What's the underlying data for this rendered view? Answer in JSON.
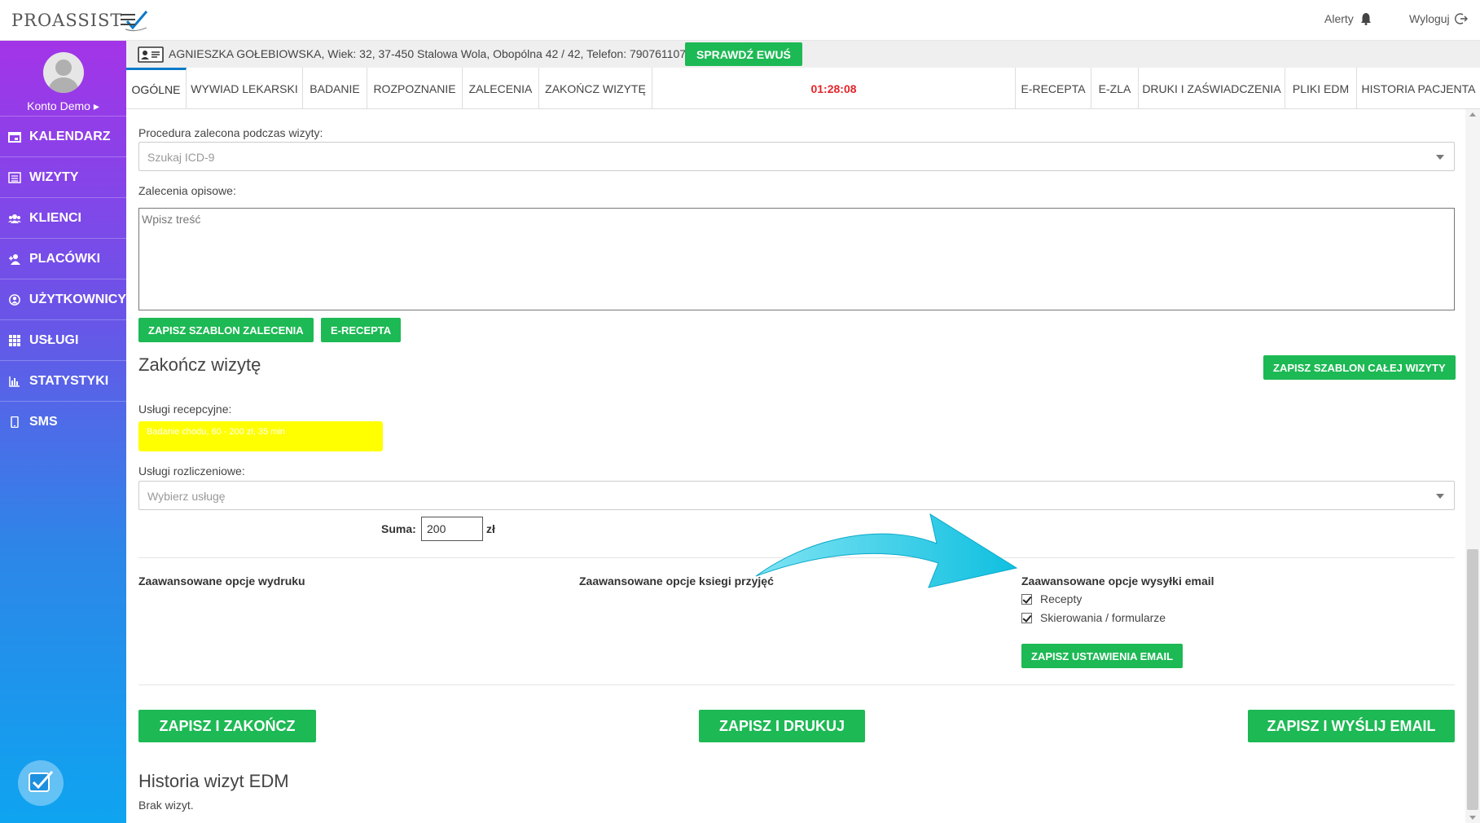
{
  "header": {
    "logo_text": "PROASSIST",
    "alerts_label": "Alerty",
    "logout_label": "Wyloguj"
  },
  "sidebar": {
    "account_name": "Konto Demo ▸",
    "items": [
      {
        "label": "KALENDARZ",
        "icon": "calendar-icon"
      },
      {
        "label": "WIZYTY",
        "icon": "list-icon"
      },
      {
        "label": "KLIENCI",
        "icon": "users-icon"
      },
      {
        "label": "PLACÓWKI",
        "icon": "user-plus-icon"
      },
      {
        "label": "UŻYTKOWNICY",
        "icon": "user-circle-icon"
      },
      {
        "label": "USŁUGI",
        "icon": "grid-icon"
      },
      {
        "label": "STATYSTYKI",
        "icon": "bar-chart-icon"
      },
      {
        "label": "SMS",
        "icon": "mobile-icon"
      }
    ]
  },
  "patient": {
    "info": "AGNIESZKA GOŁEBIOWSKA, Wiek: 32, 37-450 Stalowa Wola, Obopólna 42 / 42, Telefon: 790761107",
    "ewus_button": "SPRAWDŹ EWUŚ"
  },
  "tabs": {
    "ogolne": "OGÓLNE",
    "wywiad": "WYWIAD LEKARSKI",
    "badanie": "BADANIE",
    "rozpoznanie": "ROZPOZNANIE",
    "zalecenia": "ZALECENIA",
    "zakoncz": "ZAKOŃCZ WIZYTĘ",
    "timer": "01:28:08",
    "erecepta": "E-RECEPTA",
    "ezla": "E-ZLA",
    "druki": "DRUKI I ZAŚWIADCZENIA",
    "edm": "PLIKI EDM",
    "historia": "HISTORIA PACJENTA"
  },
  "form": {
    "procedure_label": "Procedura zalecona podczas wizyty:",
    "procedure_placeholder": "Szukaj ICD-9",
    "desc_label": "Zalecenia opisowe:",
    "desc_placeholder": "Wpisz treść",
    "save_template_button": "ZAPISZ SZABLON ZALECENIA",
    "erecepta_button": "E-RECEPTA",
    "finish_heading": "Zakończ wizytę",
    "save_visit_template_button": "ZAPISZ SZABLON CAŁEJ WIZYTY",
    "reception_services_label": "Usługi recepcyjne:",
    "reception_service_tag": "Badanie chodu, 60 - 200 zł, 35 min",
    "billing_services_label": "Usługi rozliczeniowe:",
    "billing_placeholder": "Wybierz usługę",
    "sum_label": "Suma:",
    "sum_value": "200",
    "currency": "zł"
  },
  "advanced": {
    "print_heading": "Zaawansowane opcje wydruku",
    "book_heading": "Zaawansowane opcje ksiegi przyjęć",
    "email_heading": "Zaawansowane opcje wysyłki email",
    "opt_prescriptions": "Recepty",
    "opt_referrals": "Skierowania / formularze",
    "save_email_button": "ZAPISZ USTAWIENIA EMAIL"
  },
  "actions": {
    "save_finish": "ZAPISZ I ZAKOŃCZ",
    "save_print": "ZAPISZ I DRUKUJ",
    "save_email": "ZAPISZ I WYŚLIJ EMAIL"
  },
  "history": {
    "heading": "Historia wizyt EDM",
    "empty": "Brak wizyt."
  },
  "colors": {
    "accent_green": "#1db954",
    "timer_red": "#e2252a",
    "active_tab_blue": "#0a79c9",
    "highlight_yellow": "#ffff00",
    "arrow_cyan": "#1ec8e6"
  }
}
